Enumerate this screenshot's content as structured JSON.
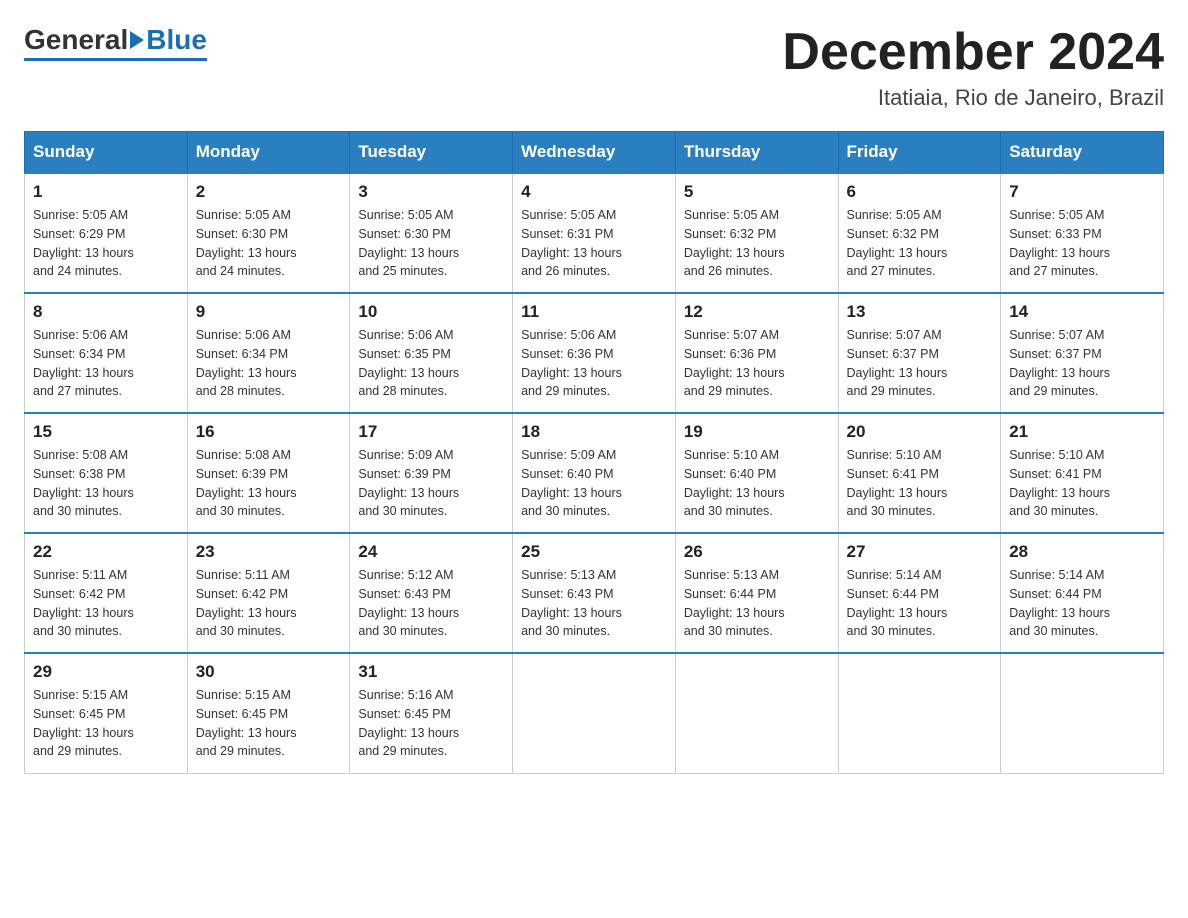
{
  "header": {
    "logo_general": "General",
    "logo_blue": "Blue",
    "month_title": "December 2024",
    "location": "Itatiaia, Rio de Janeiro, Brazil"
  },
  "days_of_week": [
    "Sunday",
    "Monday",
    "Tuesday",
    "Wednesday",
    "Thursday",
    "Friday",
    "Saturday"
  ],
  "weeks": [
    [
      {
        "day": "1",
        "sunrise": "5:05 AM",
        "sunset": "6:29 PM",
        "daylight": "13 hours and 24 minutes."
      },
      {
        "day": "2",
        "sunrise": "5:05 AM",
        "sunset": "6:30 PM",
        "daylight": "13 hours and 24 minutes."
      },
      {
        "day": "3",
        "sunrise": "5:05 AM",
        "sunset": "6:30 PM",
        "daylight": "13 hours and 25 minutes."
      },
      {
        "day": "4",
        "sunrise": "5:05 AM",
        "sunset": "6:31 PM",
        "daylight": "13 hours and 26 minutes."
      },
      {
        "day": "5",
        "sunrise": "5:05 AM",
        "sunset": "6:32 PM",
        "daylight": "13 hours and 26 minutes."
      },
      {
        "day": "6",
        "sunrise": "5:05 AM",
        "sunset": "6:32 PM",
        "daylight": "13 hours and 27 minutes."
      },
      {
        "day": "7",
        "sunrise": "5:05 AM",
        "sunset": "6:33 PM",
        "daylight": "13 hours and 27 minutes."
      }
    ],
    [
      {
        "day": "8",
        "sunrise": "5:06 AM",
        "sunset": "6:34 PM",
        "daylight": "13 hours and 27 minutes."
      },
      {
        "day": "9",
        "sunrise": "5:06 AM",
        "sunset": "6:34 PM",
        "daylight": "13 hours and 28 minutes."
      },
      {
        "day": "10",
        "sunrise": "5:06 AM",
        "sunset": "6:35 PM",
        "daylight": "13 hours and 28 minutes."
      },
      {
        "day": "11",
        "sunrise": "5:06 AM",
        "sunset": "6:36 PM",
        "daylight": "13 hours and 29 minutes."
      },
      {
        "day": "12",
        "sunrise": "5:07 AM",
        "sunset": "6:36 PM",
        "daylight": "13 hours and 29 minutes."
      },
      {
        "day": "13",
        "sunrise": "5:07 AM",
        "sunset": "6:37 PM",
        "daylight": "13 hours and 29 minutes."
      },
      {
        "day": "14",
        "sunrise": "5:07 AM",
        "sunset": "6:37 PM",
        "daylight": "13 hours and 29 minutes."
      }
    ],
    [
      {
        "day": "15",
        "sunrise": "5:08 AM",
        "sunset": "6:38 PM",
        "daylight": "13 hours and 30 minutes."
      },
      {
        "day": "16",
        "sunrise": "5:08 AM",
        "sunset": "6:39 PM",
        "daylight": "13 hours and 30 minutes."
      },
      {
        "day": "17",
        "sunrise": "5:09 AM",
        "sunset": "6:39 PM",
        "daylight": "13 hours and 30 minutes."
      },
      {
        "day": "18",
        "sunrise": "5:09 AM",
        "sunset": "6:40 PM",
        "daylight": "13 hours and 30 minutes."
      },
      {
        "day": "19",
        "sunrise": "5:10 AM",
        "sunset": "6:40 PM",
        "daylight": "13 hours and 30 minutes."
      },
      {
        "day": "20",
        "sunrise": "5:10 AM",
        "sunset": "6:41 PM",
        "daylight": "13 hours and 30 minutes."
      },
      {
        "day": "21",
        "sunrise": "5:10 AM",
        "sunset": "6:41 PM",
        "daylight": "13 hours and 30 minutes."
      }
    ],
    [
      {
        "day": "22",
        "sunrise": "5:11 AM",
        "sunset": "6:42 PM",
        "daylight": "13 hours and 30 minutes."
      },
      {
        "day": "23",
        "sunrise": "5:11 AM",
        "sunset": "6:42 PM",
        "daylight": "13 hours and 30 minutes."
      },
      {
        "day": "24",
        "sunrise": "5:12 AM",
        "sunset": "6:43 PM",
        "daylight": "13 hours and 30 minutes."
      },
      {
        "day": "25",
        "sunrise": "5:13 AM",
        "sunset": "6:43 PM",
        "daylight": "13 hours and 30 minutes."
      },
      {
        "day": "26",
        "sunrise": "5:13 AM",
        "sunset": "6:44 PM",
        "daylight": "13 hours and 30 minutes."
      },
      {
        "day": "27",
        "sunrise": "5:14 AM",
        "sunset": "6:44 PM",
        "daylight": "13 hours and 30 minutes."
      },
      {
        "day": "28",
        "sunrise": "5:14 AM",
        "sunset": "6:44 PM",
        "daylight": "13 hours and 30 minutes."
      }
    ],
    [
      {
        "day": "29",
        "sunrise": "5:15 AM",
        "sunset": "6:45 PM",
        "daylight": "13 hours and 29 minutes."
      },
      {
        "day": "30",
        "sunrise": "5:15 AM",
        "sunset": "6:45 PM",
        "daylight": "13 hours and 29 minutes."
      },
      {
        "day": "31",
        "sunrise": "5:16 AM",
        "sunset": "6:45 PM",
        "daylight": "13 hours and 29 minutes."
      },
      null,
      null,
      null,
      null
    ]
  ],
  "labels": {
    "sunrise": "Sunrise:",
    "sunset": "Sunset:",
    "daylight": "Daylight:"
  }
}
